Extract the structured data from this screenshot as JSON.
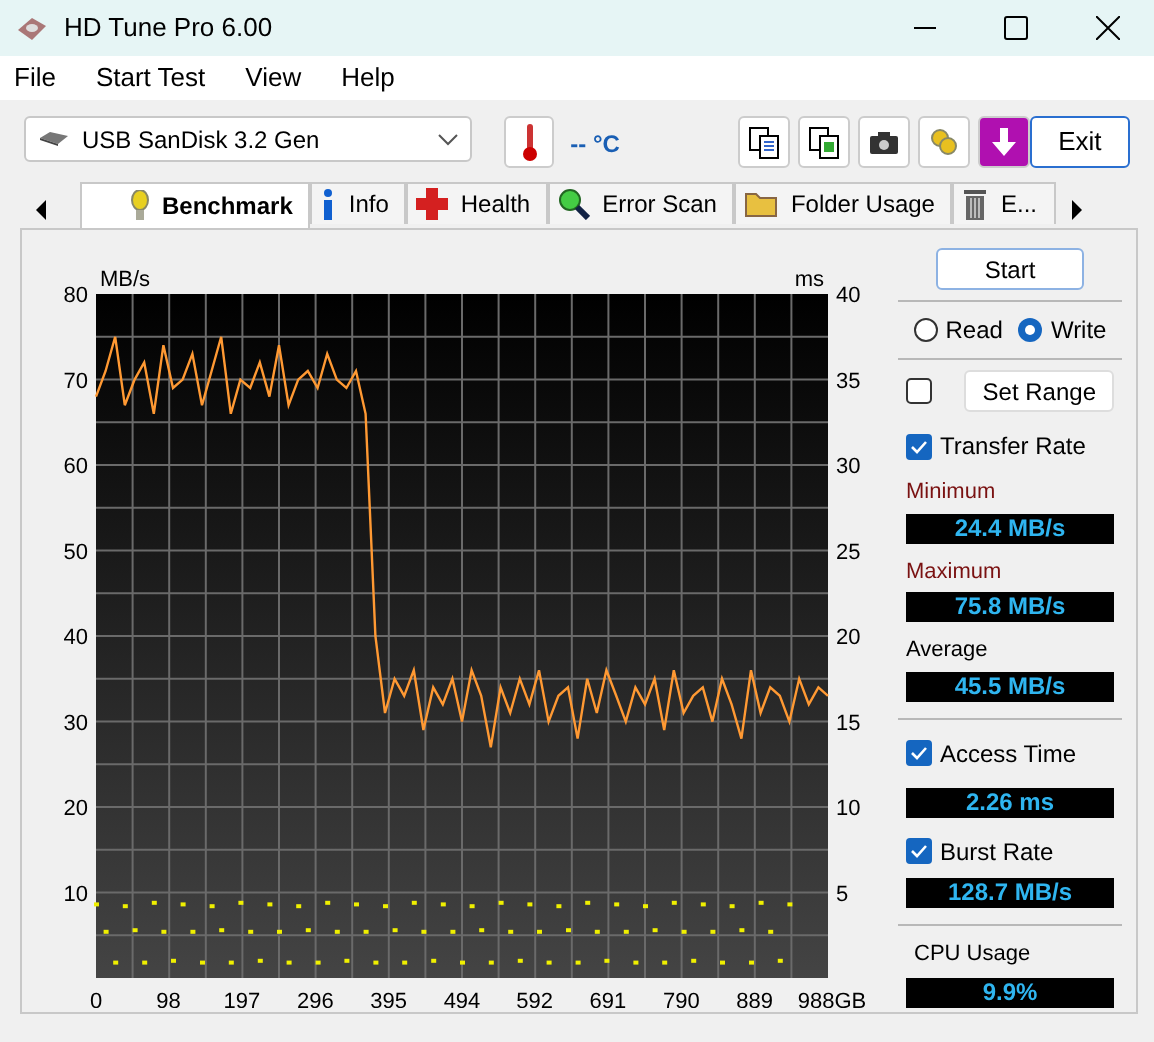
{
  "window": {
    "title": "HD Tune Pro 6.00"
  },
  "menu": [
    "File",
    "Start Test",
    "View",
    "Help"
  ],
  "toolbar": {
    "drive": "USB SanDisk 3.2 Gen",
    "temperature": "-- °C",
    "exit": "Exit"
  },
  "tabs": [
    {
      "label": "Benchmark",
      "kind": "bulb",
      "selected": true
    },
    {
      "label": "Info",
      "kind": "info",
      "selected": false
    },
    {
      "label": "Health",
      "kind": "cross",
      "selected": false
    },
    {
      "label": "Error Scan",
      "kind": "magnifier",
      "selected": false
    },
    {
      "label": "Folder Usage",
      "kind": "folder",
      "selected": false
    },
    {
      "label": "E...",
      "kind": "trash",
      "selected": false
    }
  ],
  "chart": {
    "chart_data": {
      "type": "line",
      "grid": true,
      "ylabel": "MB/s",
      "ylim": [
        0,
        80
      ],
      "yticks": [
        10,
        20,
        30,
        40,
        50,
        60,
        70,
        80
      ],
      "y2label": "ms",
      "y2lim": [
        0,
        40
      ],
      "y2ticks": [
        5,
        10,
        15,
        20,
        25,
        30,
        35,
        40
      ],
      "xlim": [
        0,
        988
      ],
      "xticks": [
        {
          "value": 0,
          "label": "0"
        },
        {
          "value": 98,
          "label": "98"
        },
        {
          "value": 197,
          "label": "197"
        },
        {
          "value": 296,
          "label": "296"
        },
        {
          "value": 395,
          "label": "395"
        },
        {
          "value": 494,
          "label": "494"
        },
        {
          "value": 592,
          "label": "592"
        },
        {
          "value": 691,
          "label": "691"
        },
        {
          "value": 790,
          "label": "790"
        },
        {
          "value": 889,
          "label": "889"
        },
        {
          "value": 988,
          "label": "988GB"
        }
      ],
      "x": [
        0,
        13,
        26,
        39,
        52,
        65,
        78,
        91,
        104,
        117,
        130,
        143,
        156,
        169,
        182,
        195,
        208,
        221,
        234,
        247,
        260,
        273,
        286,
        299,
        312,
        325,
        338,
        351,
        364,
        377,
        390,
        403,
        416,
        429,
        442,
        455,
        468,
        481,
        494,
        507,
        520,
        533,
        546,
        559,
        572,
        585,
        598,
        611,
        624,
        637,
        650,
        663,
        676,
        689,
        702,
        715,
        728,
        741,
        754,
        767,
        780,
        793,
        806,
        819,
        832,
        845,
        858,
        871,
        884,
        897,
        910,
        923,
        936,
        949,
        962,
        975,
        988
      ],
      "series": [
        {
          "name": "Transfer Rate",
          "color": "#ff9933",
          "values": [
            68,
            71,
            75,
            67,
            70,
            72,
            66,
            74,
            69,
            70,
            73,
            67,
            71,
            75,
            66,
            70,
            69,
            72,
            68,
            74,
            67,
            70,
            71,
            69,
            73,
            70,
            69,
            71,
            66,
            40,
            31,
            35,
            33,
            36,
            29,
            34,
            32,
            35,
            30,
            36,
            33,
            27,
            34,
            31,
            35,
            32,
            36,
            30,
            33,
            34,
            28,
            35,
            31,
            36,
            33,
            30,
            34,
            32,
            35,
            29,
            36,
            31,
            33,
            34,
            30,
            35,
            32,
            28,
            36,
            31,
            34,
            33,
            30,
            35,
            32,
            34,
            33
          ]
        },
        {
          "name": "Access Time",
          "color": "#f0f000",
          "type": "scatter",
          "axis": "y2",
          "values": [
            4.3,
            2.7,
            0.9,
            4.2,
            2.8,
            0.9,
            4.4,
            2.7,
            1.0,
            4.3,
            2.7,
            0.9,
            4.2,
            2.8,
            0.9,
            4.4,
            2.7,
            1.0,
            4.3,
            2.7,
            0.9,
            4.2,
            2.8,
            0.9,
            4.4,
            2.7,
            1.0,
            4.3,
            2.7,
            0.9,
            4.2,
            2.8,
            0.9,
            4.4,
            2.7,
            1.0,
            4.3,
            2.7,
            0.9,
            4.2,
            2.8,
            0.9,
            4.4,
            2.7,
            1.0,
            4.3,
            2.7,
            0.9,
            4.2,
            2.8,
            0.9,
            4.4,
            2.7,
            1.0,
            4.3,
            2.7,
            0.9,
            4.2,
            2.8,
            0.9,
            4.4,
            2.7,
            1.0,
            4.3,
            2.7,
            0.9,
            4.2,
            2.8,
            0.9,
            4.4,
            2.7,
            1.0,
            4.3,
            null,
            null,
            null,
            null
          ]
        }
      ]
    }
  },
  "panel": {
    "start": "Start",
    "modes": [
      {
        "label": "Read",
        "selected": false
      },
      {
        "label": "Write",
        "selected": true
      }
    ],
    "range": {
      "checked": false,
      "label": "Set Range"
    },
    "transfer_rate": {
      "checked": true,
      "stats": [
        {
          "label": "Minimum",
          "color": "#7a1212",
          "value": "24.4 MB/s"
        },
        {
          "label": "Maximum",
          "color": "#7a1212",
          "value": "75.8 MB/s"
        },
        {
          "label": "Average",
          "color": "#000000",
          "value": "45.5 MB/s"
        }
      ]
    },
    "access_time": {
      "checked": true,
      "value": "2.26 ms"
    },
    "burst_rate": {
      "label": "Burst Rate",
      "checked": true,
      "value": "128.7 MB/s"
    },
    "cpu": {
      "label": "CPU Usage",
      "value": "9.9%"
    }
  }
}
